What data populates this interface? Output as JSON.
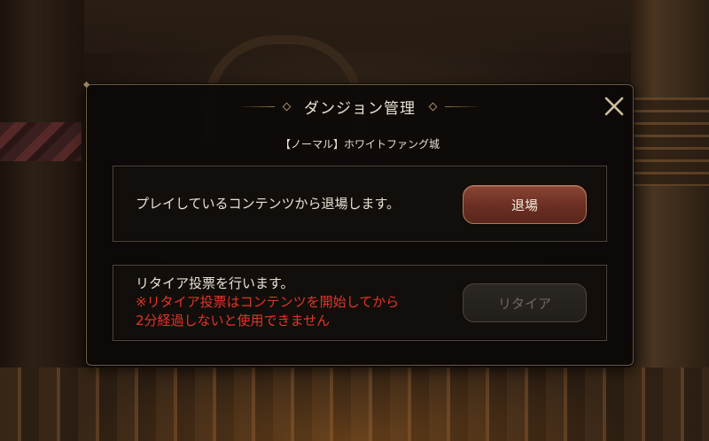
{
  "dialog": {
    "title": "ダンジョン管理",
    "subtitle": "【ノーマル】ホワイトファング城"
  },
  "exit_section": {
    "text": "プレイしているコンテンツから退場します。",
    "button_label": "退場"
  },
  "retire_section": {
    "text": "リタイア投票を行います。",
    "warning_line1": "※リタイア投票はコンテンツを開始してから",
    "warning_line2": "2分経過しないと使用できません",
    "button_label": "リタイア",
    "button_enabled": false
  },
  "icons": {
    "close": "close-icon",
    "title_ornament": "diamond-ornament-icon"
  },
  "colors": {
    "warning_text": "#e0362a",
    "exit_button": "#7a3a2c",
    "frame_border": "#6b5a43"
  }
}
